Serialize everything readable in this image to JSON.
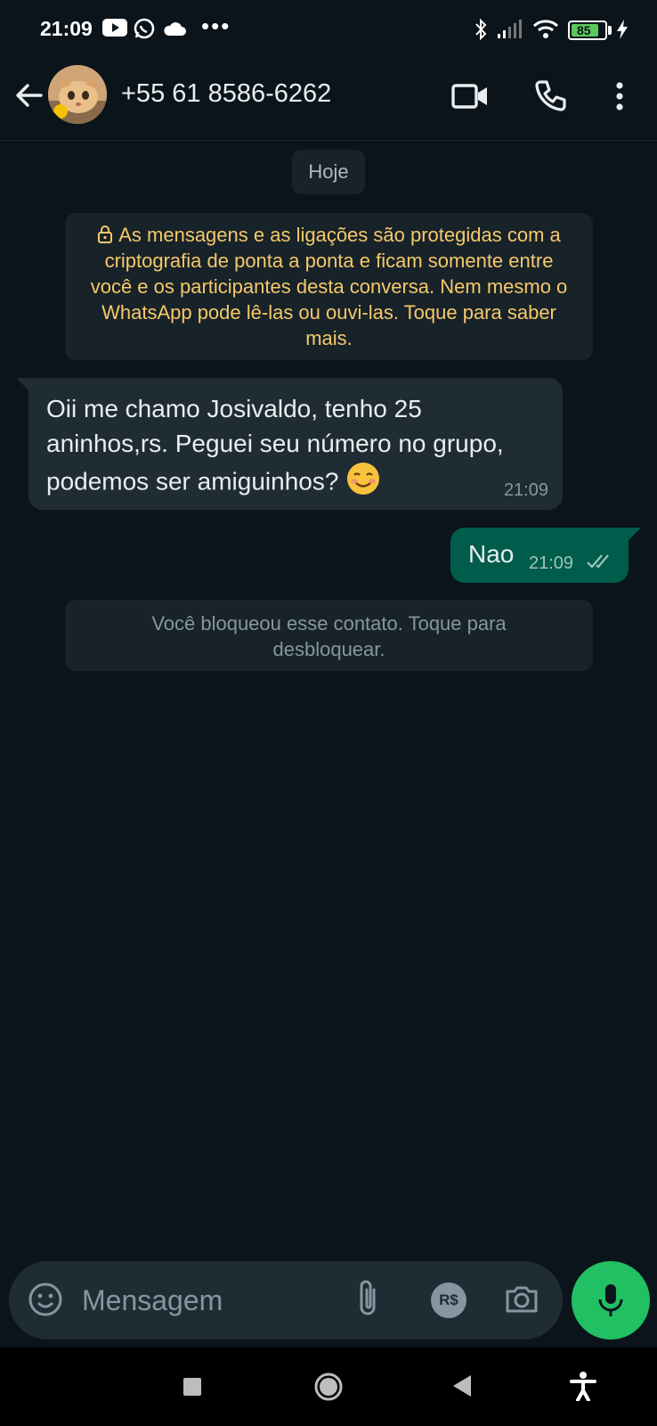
{
  "status_bar": {
    "time": "21:09",
    "icons": [
      "youtube-icon",
      "whatsapp-icon",
      "cloud-icon",
      "more-dots-icon",
      "bluetooth-icon",
      "signal-icon",
      "wifi-icon",
      "battery-icon",
      "charging-icon"
    ],
    "dots": "•••",
    "battery_level": "85"
  },
  "header": {
    "contact_name": "+55 61 8586-6262",
    "icons": [
      "back-arrow-icon",
      "video-call-icon",
      "voice-call-icon",
      "more-options-icon"
    ]
  },
  "chat": {
    "date_chip": "Hoje",
    "encryption_notice": "As mensagens e as ligações são protegidas com a criptografia de ponta a ponta e ficam somente entre você e os participantes desta conversa. Nem mesmo o WhatsApp pode lê-las ou ouvi-las. Toque para saber mais.",
    "messages": [
      {
        "direction": "incoming",
        "text": "Oii me chamo Josivaldo, tenho 25 aninhos,rs. Peguei seu número no grupo, podemos ser amiguinhos?",
        "emoji": "smiling-face-icon",
        "time": "21:09"
      },
      {
        "direction": "outgoing",
        "text": "Nao",
        "time": "21:09",
        "status": "delivered"
      }
    ],
    "blocked_notice": "Você bloqueou esse contato. Toque para desbloquear."
  },
  "composer": {
    "placeholder": "Mensagem",
    "pay_label": "R$",
    "icons": [
      "emoji-icon",
      "attach-icon",
      "payment-icon",
      "camera-icon",
      "mic-icon"
    ]
  },
  "colors": {
    "background": "#0b141a",
    "incoming_bubble": "#202c33",
    "outgoing_bubble": "#005c4b",
    "accent_green": "#21c063",
    "notice_text": "#f5c969"
  }
}
